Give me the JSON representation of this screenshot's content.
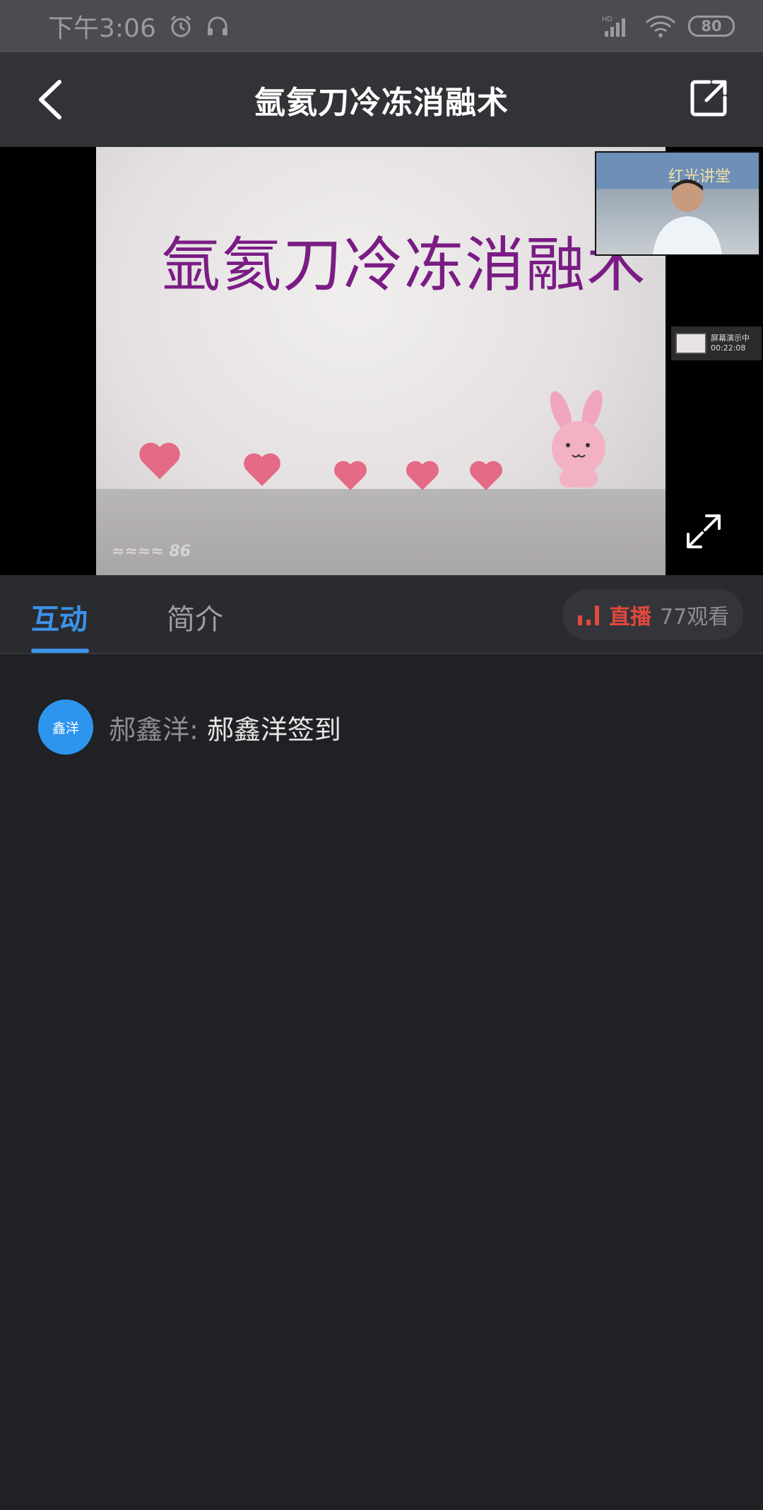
{
  "status_bar": {
    "time": "下午3:06",
    "icons": [
      "alarm-icon",
      "headset-icon",
      "hd-signal-icon",
      "wifi-icon"
    ],
    "battery": "80"
  },
  "header": {
    "title": "氩氦刀冷冻消融术",
    "back_icon": "chevron-left-icon",
    "share_icon": "share-external-icon"
  },
  "video": {
    "slide_title": "氩氦刀冷冻消融术",
    "watermark": "≈≈≈≈ 86",
    "pip_banner": "红光讲堂",
    "screen_share": {
      "label": "屏幕演示中",
      "duration": "00:22:08"
    },
    "fullscreen_icon": "expand-icon"
  },
  "tabs": [
    {
      "label": "互动",
      "active": true
    },
    {
      "label": "简介",
      "active": false
    }
  ],
  "live": {
    "label": "直播",
    "viewers": "77观看",
    "icon": "bar-chart-icon",
    "accent": "#e2483e"
  },
  "chat": {
    "messages": [
      {
        "avatar_text": "鑫洋",
        "name": "郝鑫洋",
        "separator": ":",
        "content": "郝鑫洋签到"
      }
    ]
  },
  "colors": {
    "accent": "#3b93ea",
    "background": "#202124"
  }
}
